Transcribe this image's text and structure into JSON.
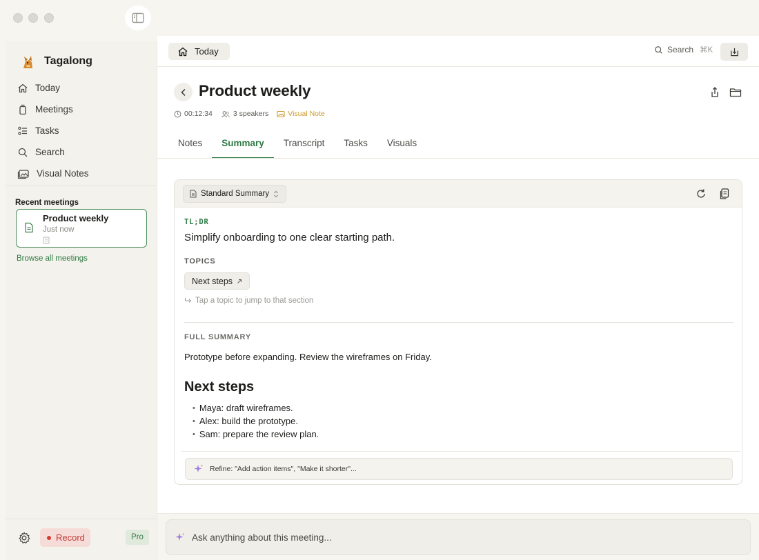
{
  "app": {
    "name": "Tagalong"
  },
  "sidebar": {
    "nav": [
      {
        "label": "Today",
        "icon": "home-icon"
      },
      {
        "label": "Meetings",
        "icon": "meetings-icon"
      },
      {
        "label": "Tasks",
        "icon": "tasks-icon"
      },
      {
        "label": "Search",
        "icon": "search-icon"
      },
      {
        "label": "Visual Notes",
        "icon": "visual-notes-icon"
      }
    ],
    "recent_title": "Recent meetings",
    "recent": [
      {
        "title": "Product weekly",
        "subtitle": "Just now"
      }
    ],
    "browse_label": "Browse all meetings",
    "record_label": "Record",
    "plan_badge": "Pro"
  },
  "toolbar": {
    "today_label": "Today",
    "search_label": "Search",
    "search_shortcut": "⌘K"
  },
  "meeting": {
    "title": "Product weekly",
    "duration": "00:12:34",
    "speakers": "3 speakers",
    "visual_note": "Visual Note"
  },
  "tabs": [
    {
      "label": "Notes",
      "active": false
    },
    {
      "label": "Summary",
      "active": true
    },
    {
      "label": "Transcript",
      "active": false
    },
    {
      "label": "Tasks",
      "active": false
    },
    {
      "label": "Visuals",
      "active": false
    }
  ],
  "summary": {
    "template": "Standard Summary",
    "tldr_label": "TL;DR",
    "tldr": "Simplify onboarding to one clear starting path.",
    "topics_label": "TOPICS",
    "topics": [
      "Next steps"
    ],
    "topic_hint": "Tap a topic to jump to that section",
    "full_label": "FULL SUMMARY",
    "full_text": "Prototype before expanding. Review the wireframes on Friday.",
    "next_steps_heading": "Next steps",
    "next_steps": [
      "Maya: draft wireframes.",
      "Alex: build the prototype.",
      "Sam: prepare the review plan."
    ],
    "refine_placeholder": "Refine: \"Add action items\", \"Make it shorter\"..."
  },
  "ask": {
    "placeholder": "Ask anything about this meeting..."
  },
  "colors": {
    "accent_green": "#2f7a45",
    "record_red": "#d63b32",
    "visual_note_amber": "#cc9a2e",
    "sparkle_purple": "#a07be0"
  }
}
